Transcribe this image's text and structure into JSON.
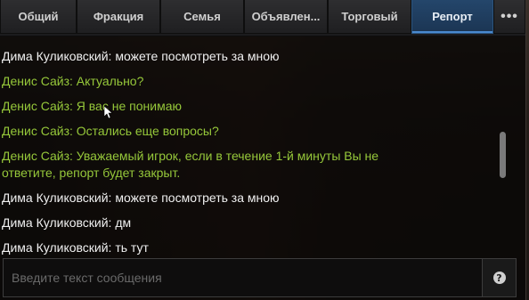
{
  "tabs": [
    {
      "label": "Общий",
      "active": false
    },
    {
      "label": "Фракция",
      "active": false
    },
    {
      "label": "Семья",
      "active": false
    },
    {
      "label": "Объявлен...",
      "active": false
    },
    {
      "label": "Торговый",
      "active": false
    },
    {
      "label": "Репорт",
      "active": true
    }
  ],
  "more_label": "•••",
  "messages": [
    {
      "text": "Дима Куликовский: можете посмотреть за мною",
      "type": "player"
    },
    {
      "text": "Денис Сайз: Актуально?",
      "type": "admin"
    },
    {
      "text": "Денис Сайз: Я вас не понимаю",
      "type": "admin"
    },
    {
      "text": "Денис Сайз: Остались еще вопросы?",
      "type": "admin"
    },
    {
      "text": "Денис Сайз: Уважаемый игрок, если в течение 1-й минуты Вы не ответите, репорт будет закрыт.",
      "type": "admin"
    },
    {
      "text": "Дима Куликовский: можете посмотреть за мною",
      "type": "player"
    },
    {
      "text": "Дима Куликовский: дм",
      "type": "player"
    },
    {
      "text": "Дима Куликовский: ть тут",
      "type": "player"
    }
  ],
  "input": {
    "placeholder": "Введите текст сообщения",
    "value": ""
  },
  "help_icon": "question-circle-icon",
  "help_label": "?",
  "colors": {
    "admin": "#96c83a",
    "player": "#f0f0f0",
    "active_tab": "#24466b"
  }
}
